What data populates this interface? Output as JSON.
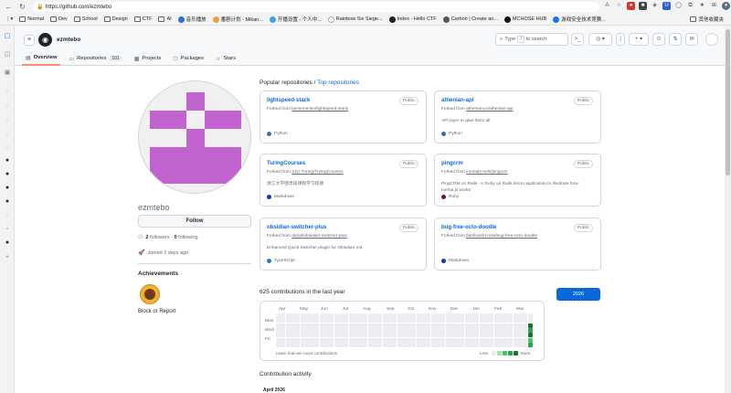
{
  "browser": {
    "url": "https://github.com/ezmtebo",
    "bookmarks": [
      {
        "label": "Normal"
      },
      {
        "label": "Dev"
      },
      {
        "label": "School"
      },
      {
        "label": "Design"
      },
      {
        "label": "CTF"
      },
      {
        "label": "AI"
      },
      {
        "label": "音乐播放"
      },
      {
        "label": "番剧计划 - Mikan..."
      },
      {
        "label": "开播设置 - 个人中..."
      },
      {
        "label": "Rainbow Six Siege..."
      },
      {
        "label": "Index - Hello CTF"
      },
      {
        "label": "Carbon | Create an..."
      },
      {
        "label": "MCHOSE HUB"
      },
      {
        "label": "游戏安全技术竞赛..."
      }
    ],
    "other_favorites": "其他收藏夹"
  },
  "header": {
    "username": "ezmtebo",
    "search_prefix": "Type",
    "search_key": "/",
    "search_suffix": "to search",
    "tabs": [
      {
        "label": "Overview",
        "icon": "book-icon"
      },
      {
        "label": "Repositories",
        "count": "101",
        "icon": "repo-icon"
      },
      {
        "label": "Projects",
        "icon": "table-icon"
      },
      {
        "label": "Packages",
        "icon": "package-icon"
      },
      {
        "label": "Stars",
        "icon": "star-icon"
      }
    ]
  },
  "profile": {
    "name": "ezmtebo",
    "follow_label": "Follow",
    "followers_count": "2",
    "followers_label": "followers",
    "following_count": "0",
    "following_label": "following",
    "joined": "Joined 2 days ago",
    "achievements_title": "Achievements",
    "block_report": "Block or Report"
  },
  "popular": {
    "title": "Popular repositories",
    "link": "Top repositories",
    "repos": [
      {
        "name": "lightspeed-stack",
        "visibility": "Public",
        "forked_prefix": "Forked from",
        "forked_from": "lamsonenko/lightspeed-stack",
        "description": "",
        "language": "Python",
        "lang_color": "#3572A5"
      },
      {
        "name": "athenian-api",
        "visibility": "Public",
        "forked_prefix": "Forked from",
        "forked_from": "athenianco/athenian-api",
        "description": "API layer to glue them all.",
        "language": "Python",
        "lang_color": "#3572A5"
      },
      {
        "name": "TuringCourses",
        "visibility": "Public",
        "forked_prefix": "Forked from",
        "forked_from": "ZJU-Turing/TuringCourses",
        "description": "浙江大学图灵班课程学习指南",
        "language": "Markdown",
        "lang_color": "#083fa1"
      },
      {
        "name": "pingcrm",
        "visibility": "Public",
        "forked_prefix": "Forked from",
        "forked_from": "inertiajs-rails/pingcrm",
        "description": "PingCRM on Rails - A Ruby on Rails demo application to illustrate how Inertia.js works",
        "language": "Ruby",
        "lang_color": "#701516"
      },
      {
        "name": "obsidian-switcher-plus",
        "visibility": "Public",
        "forked_prefix": "Forked from",
        "forked_from": "darlal/obsidian-switcher-plus",
        "description": "Enhanced Quick Switcher plugin for Obsidian.md",
        "language": "TypeScript",
        "lang_color": "#3178c6"
      },
      {
        "name": "bug-free-octo-doodle",
        "visibility": "Public",
        "forked_prefix": "Forked from",
        "forked_from": "flashworld-new/bug-free-octo-doodle",
        "description": "",
        "language": "Markdown",
        "lang_color": "#083fa1"
      }
    ]
  },
  "contributions": {
    "title": "625 contributions in the last year",
    "months": [
      "Apr",
      "May",
      "Jun",
      "Jul",
      "Aug",
      "Sep",
      "Oct",
      "Nov",
      "Dec",
      "Jan",
      "Feb",
      "Mar"
    ],
    "days": [
      "Mon",
      "Wed",
      "Fri"
    ],
    "learn": "Learn how we count contributions",
    "less": "Less",
    "more": "More",
    "year": "2026",
    "level_colors": [
      "#ebedf0",
      "#9be9a8",
      "#40c463",
      "#30a14e",
      "#216e39"
    ],
    "recent_levels": [
      4,
      3,
      4,
      2,
      3
    ]
  },
  "activity": {
    "title": "Contribution activity",
    "month": "April 2026"
  }
}
